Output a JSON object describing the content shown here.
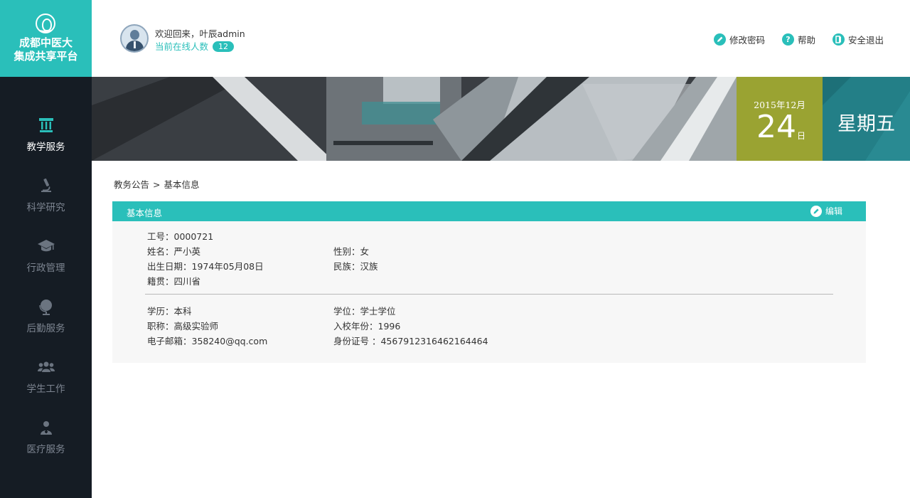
{
  "logo": {
    "line1": "成都中医大",
    "line2": "集成共享平台"
  },
  "header": {
    "welcome": "欢迎回来，叶辰admin",
    "online_label": "当前在线人数",
    "online_count": "12",
    "actions": [
      {
        "label": "修改密码",
        "icon": "pencil-icon"
      },
      {
        "label": "帮助",
        "icon": "help-icon"
      },
      {
        "label": "安全退出",
        "icon": "logout-icon"
      }
    ]
  },
  "sidebar": {
    "items": [
      {
        "label": "教学服务",
        "icon": "pillar-icon",
        "active": true
      },
      {
        "label": "科学研究",
        "icon": "microscope-icon",
        "active": false
      },
      {
        "label": "行政管理",
        "icon": "mortarboard-icon",
        "active": false
      },
      {
        "label": "后勤服务",
        "icon": "globe-icon",
        "active": false
      },
      {
        "label": "学生工作",
        "icon": "group-icon",
        "active": false
      },
      {
        "label": "医疗服务",
        "icon": "doctor-icon",
        "active": false
      }
    ]
  },
  "date": {
    "year_month": "2015年12月",
    "day": "24",
    "day_suffix": "日",
    "weekday": "星期五"
  },
  "breadcrumb": {
    "parent": "教务公告",
    "separator": ">",
    "current": "基本信息"
  },
  "panel": {
    "title": "基本信息",
    "edit_label": "编辑",
    "fields": {
      "job_no": "工号：0000721",
      "name": "姓名：严小英",
      "gender": "性别：女",
      "birthdate": "出生日期：1974年05月08日",
      "ethnicity": "民族：汉族",
      "origin": "籍贯：四川省",
      "education": "学历：本科",
      "degree": "学位：学士学位",
      "title": "职称：高级实验师",
      "enroll_year": "入校年份：1996",
      "email": "电子邮箱：358240@qq.com",
      "id_no": "身份证号 ：4567912316462164464"
    }
  },
  "colors": {
    "accent": "#2abfba",
    "sidebar_bg": "#151c24",
    "date_bg": "#9aa332",
    "week_bg": "#237f87"
  }
}
